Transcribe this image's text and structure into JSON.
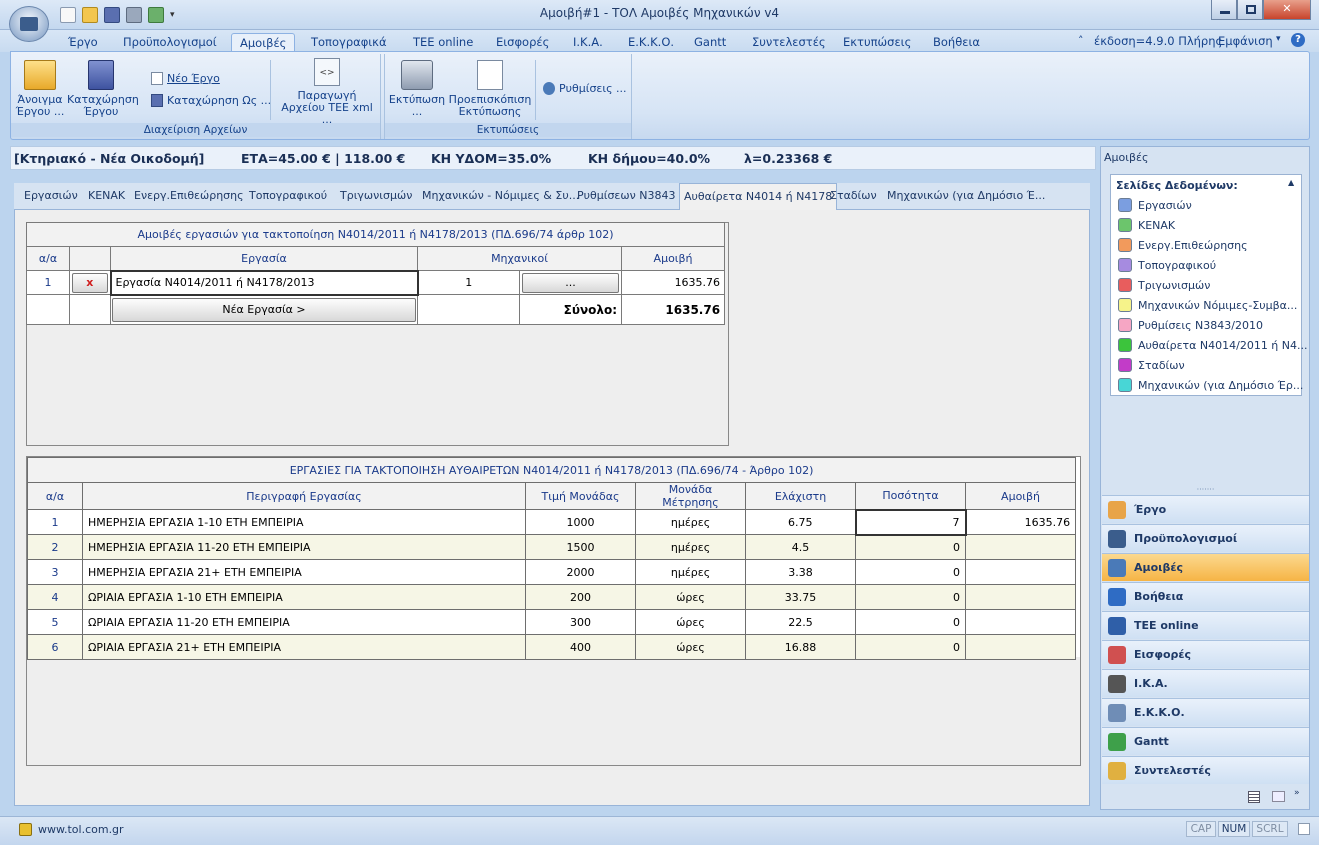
{
  "window": {
    "title": "Αμοιβή#1 - ΤΟΛ Αμοιβές Μηχανικών v4"
  },
  "ribbon_tabs": [
    "Έργο",
    "Προϋπολογισμοί",
    "Αμοιβές",
    "Τοπογραφικά",
    "TEE online",
    "Εισφορές",
    "Ι.Κ.Α.",
    "Ε.Κ.Κ.Ο.",
    "Gantt",
    "Συντελεστές",
    "Εκτυπώσεις",
    "Βοήθεια"
  ],
  "ribbon_right": {
    "version": "έκδοση=4.9.0 Πλήρης",
    "view": "Εμφάνιση"
  },
  "ribbon": {
    "open_label": "Άνοιγμα Έργου ...",
    "save_label": "Καταχώρηση Έργου",
    "new_project": "Νέο Έργο",
    "save_as": "Καταχώρηση Ως ...",
    "generate_xml": "Παραγωγή Αρχείου ΤΕΕ xml ...",
    "group_files": "Διαχείριση Αρχείων",
    "print": "Εκτύπωση ...",
    "preview": "Προεπισκόπιση Εκτύπωσης",
    "settings": "Ρυθμίσεις ...",
    "group_print": "Εκτυπώσεις"
  },
  "info": {
    "project": "[Κτηριακό - Νέα Οικοδομή]",
    "eta": "ΕΤΑ=45.00 € | 118.00 €",
    "kh_ydom": "ΚΗ ΥΔΟΜ=35.0%",
    "kh_dimou": "ΚΗ δήμου=40.0%",
    "lambda": "λ=0.23368 €"
  },
  "subtabs": [
    "Εργασιών",
    "ΚΕΝΑΚ",
    "Ενεργ.Επιθεώρησης",
    "Τοπογραφικού",
    "Τριγωνισμών",
    "Μηχανικών - Νόμιμες & Συ...",
    "Ρυθμίσεων Ν3843",
    "Αυθαίρετα Ν4014 ή Ν4178",
    "Σταδίων",
    "Μηχανικών (για Δημόσιο Έ..."
  ],
  "fees_table": {
    "caption": "Αμοιβές εργασιών για τακτοποίηση Ν4014/2011 ή Ν4178/2013 (ΠΔ.696/74 άρθρ 102)",
    "headers": [
      "α/α",
      "",
      "Εργασία",
      "Μηχανικοί",
      "",
      "Αμοιβή"
    ],
    "row": {
      "aa": "1",
      "delete": "x",
      "work": "Εργασία Ν4014/2011 ή Ν4178/2013",
      "engineers": "1",
      "dots": "...",
      "fee": "1635.76"
    },
    "new_work": "Νέα Εργασία >",
    "total_label": "Σύνολο:",
    "total_value": "1635.76"
  },
  "works_table": {
    "caption": "ΕΡΓΑΣΙΕΣ ΓΙΑ ΤΑΚΤΟΠΟΙΗΣΗ ΑΥΘΑΙΡΕΤΩΝ Ν4014/2011 ή Ν4178/2013 (ΠΔ.696/74 - Άρθρο 102)",
    "headers": [
      "α/α",
      "Περιγραφή Εργασίας",
      "Τιμή Μονάδας",
      "Μονάδα Μέτρησης",
      "Ελάχιστη",
      "Ποσότητα",
      "Αμοιβή"
    ],
    "rows": [
      {
        "aa": "1",
        "desc": "ΗΜΕΡΗΣΙΑ ΕΡΓΑΣΙΑ 1-10 ΕΤΗ ΕΜΠΕΙΡΙΑ",
        "price": "1000",
        "unit": "ημέρες",
        "min": "6.75",
        "qty": "7",
        "fee": "1635.76"
      },
      {
        "aa": "2",
        "desc": "ΗΜΕΡΗΣΙΑ ΕΡΓΑΣΙΑ 11-20 ΕΤΗ ΕΜΠΕΙΡΙΑ",
        "price": "1500",
        "unit": "ημέρες",
        "min": "4.5",
        "qty": "0",
        "fee": ""
      },
      {
        "aa": "3",
        "desc": "ΗΜΕΡΗΣΙΑ ΕΡΓΑΣΙΑ 21+ ΕΤΗ ΕΜΠΕΙΡΙΑ",
        "price": "2000",
        "unit": "ημέρες",
        "min": "3.38",
        "qty": "0",
        "fee": ""
      },
      {
        "aa": "4",
        "desc": "ΩΡΙΑΙΑ ΕΡΓΑΣΙΑ 1-10 ΕΤΗ ΕΜΠΕΙΡΙΑ",
        "price": "200",
        "unit": "ώρες",
        "min": "33.75",
        "qty": "0",
        "fee": ""
      },
      {
        "aa": "5",
        "desc": "ΩΡΙΑΙΑ ΕΡΓΑΣΙΑ 11-20 ΕΤΗ ΕΜΠΕΙΡΙΑ",
        "price": "300",
        "unit": "ώρες",
        "min": "22.5",
        "qty": "0",
        "fee": ""
      },
      {
        "aa": "6",
        "desc": "ΩΡΙΑΙΑ ΕΡΓΑΣΙΑ 21+ ΕΤΗ ΕΜΠΕΙΡΙΑ",
        "price": "400",
        "unit": "ώρες",
        "min": "16.88",
        "qty": "0",
        "fee": ""
      }
    ]
  },
  "right_pane": {
    "title": "Αμοιβές",
    "list_title": "Σελίδες Δεδομένων:",
    "pages": [
      {
        "label": "Εργασιών",
        "color": "#7b9ee0"
      },
      {
        "label": "ΚΕΝΑΚ",
        "color": "#6cc56c"
      },
      {
        "label": "Ενεργ.Επιθεώρησης",
        "color": "#f29a5c"
      },
      {
        "label": "Τοπογραφικού",
        "color": "#a68be0"
      },
      {
        "label": "Τριγωνισμών",
        "color": "#e85d5d"
      },
      {
        "label": "Μηχανικών Νόμιμες-Συμβα...",
        "color": "#f6f38a"
      },
      {
        "label": "Ρυθμίσεις Ν3843/2010",
        "color": "#f6a6c4"
      },
      {
        "label": "Αυθαίρετα Ν4014/2011 ή Ν4...",
        "color": "#3cc43c"
      },
      {
        "label": "Σταδίων",
        "color": "#c23cc8"
      },
      {
        "label": "Μηχανικών (για Δημόσιο Έρ...",
        "color": "#48d6d6"
      }
    ],
    "nav": [
      {
        "label": "Έργο",
        "icon": "house-icon",
        "color": "#e8a448"
      },
      {
        "label": "Προϋπολογισμοί",
        "icon": "sigma-icon",
        "color": "#3b5d8c"
      },
      {
        "label": "Αμοιβές",
        "icon": "fees-icon",
        "color": "#4a7ab8"
      },
      {
        "label": "Βοήθεια",
        "icon": "help-icon",
        "color": "#2f6cc4"
      },
      {
        "label": "TEE online",
        "icon": "tee-icon",
        "color": "#2f5fa8"
      },
      {
        "label": "Εισφορές",
        "icon": "document-icon",
        "color": "#d05050"
      },
      {
        "label": "Ι.Κ.Α.",
        "icon": "ika-icon",
        "color": "#555555"
      },
      {
        "label": "Ε.Κ.Κ.Ο.",
        "icon": "list-icon",
        "color": "#6f8db6"
      },
      {
        "label": "Gantt",
        "icon": "gantt-icon",
        "color": "#3ea04a"
      },
      {
        "label": "Συντελεστές",
        "icon": "coefficients-icon",
        "color": "#e0b040"
      }
    ]
  },
  "status": {
    "url": "www.tol.com.gr",
    "cap": "CAP",
    "num": "NUM",
    "scrl": "SCRL"
  }
}
